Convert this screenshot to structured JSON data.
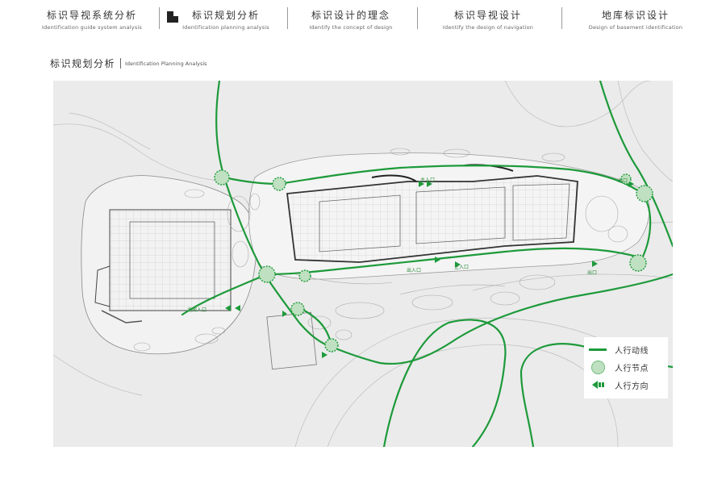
{
  "nav": [
    {
      "zh": "标识导视系统分析",
      "en": "Identification guide system analysis"
    },
    {
      "zh": "标识规划分析",
      "en": "Identification planning analysis"
    },
    {
      "zh": "标识设计的理念",
      "en": "Identify the concept of design"
    },
    {
      "zh": "标识导视设计",
      "en": "Identify the design of navigation"
    },
    {
      "zh": "地库标识设计",
      "en": "Design of basement identification"
    }
  ],
  "active_nav_index": 1,
  "section": {
    "zh": "标识规划分析",
    "en": "Identification Planning Analysis"
  },
  "map_labels": {
    "north_entrance": "北面入口",
    "exit_right": "出口",
    "exit_top": "出口",
    "entrance_top": "主入口",
    "exit_mid": "出入口",
    "entrance_mid": "主入口"
  },
  "legend": [
    {
      "icon": "pedestrian-route-line",
      "label": "人行动线"
    },
    {
      "icon": "pedestrian-node-circle",
      "label": "人行节点"
    },
    {
      "icon": "pedestrian-direction-arrow",
      "label": "人行方向"
    }
  ],
  "colors": {
    "route": "#1d9a3a",
    "node_fill": "#bfe0c1",
    "map_bg": "#ebebeb"
  }
}
